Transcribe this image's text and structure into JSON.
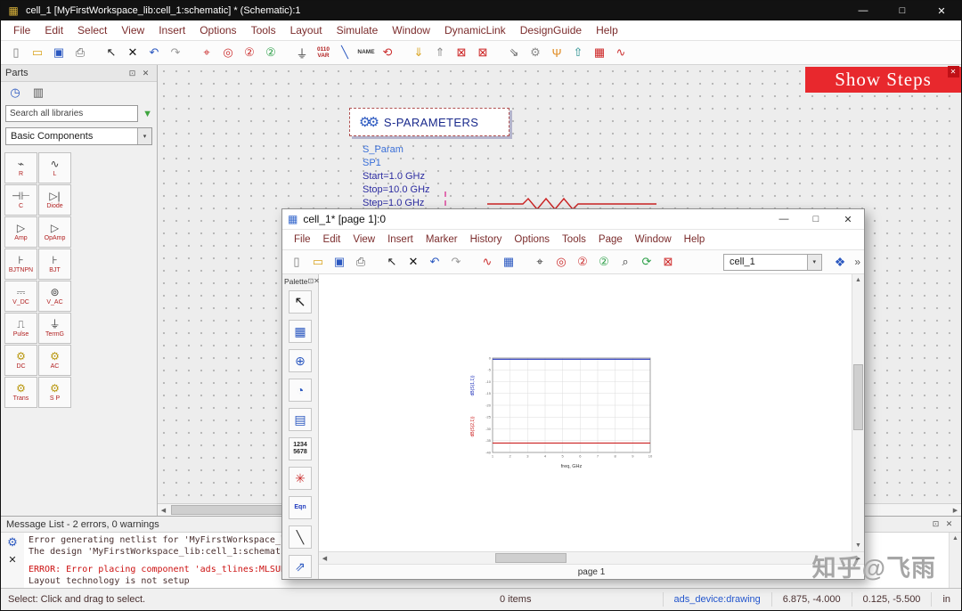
{
  "window": {
    "icon_glyph": "▦",
    "title": "cell_1 [MyFirstWorkspace_lib:cell_1:schematic] * (Schematic):1",
    "controls": {
      "minimize": "—",
      "maximize": "□",
      "close": "✕"
    }
  },
  "menu": [
    "File",
    "Edit",
    "Select",
    "View",
    "Insert",
    "Options",
    "Tools",
    "Layout",
    "Simulate",
    "Window",
    "DynamicLink",
    "DesignGuide",
    "Help"
  ],
  "toolbar": [
    {
      "name": "new-file-button",
      "glyph": "▯",
      "color": "#777777"
    },
    {
      "name": "open-folder-button",
      "glyph": "▭",
      "color": "#d9a31f"
    },
    {
      "name": "save-button",
      "glyph": "▣",
      "color": "#2b58c0"
    },
    {
      "name": "print-button",
      "glyph": "⎙",
      "color": "#555555"
    },
    {
      "name": "select-cursor-button",
      "glyph": "↖",
      "color": "#222222",
      "cls": "group-start"
    },
    {
      "name": "delete-button",
      "glyph": "✕",
      "color": "#111111"
    },
    {
      "name": "undo-button",
      "glyph": "↶",
      "color": "#2b58c0"
    },
    {
      "name": "redo-button",
      "glyph": "↷",
      "color": "#999999"
    },
    {
      "name": "pan-view-button",
      "glyph": "⌖",
      "color": "#cc3030",
      "cls": "group-start"
    },
    {
      "name": "zoom-area-button",
      "glyph": "◎",
      "color": "#cc3030"
    },
    {
      "name": "zoom-out-x2-button",
      "glyph": "②",
      "color": "#cc3030"
    },
    {
      "name": "zoom-in-x2-button",
      "glyph": "②",
      "color": "#2fa04a"
    },
    {
      "name": "insert-ground-button",
      "glyph": "⏚",
      "color": "#333333",
      "cls": "group-start"
    },
    {
      "name": "insert-var-button",
      "glyph": "0110 VAR",
      "color": "#b22222"
    },
    {
      "name": "insert-wire-button",
      "glyph": "╲",
      "color": "#2b58c0"
    },
    {
      "name": "wire-name-button",
      "glyph": "NAME",
      "color": "#333333"
    },
    {
      "name": "wire-loop-button",
      "glyph": "⟲",
      "color": "#cc3030"
    },
    {
      "name": "import-button",
      "glyph": "⇓",
      "color": "#d9a31f",
      "cls": "group-start"
    },
    {
      "name": "export-button",
      "glyph": "⇑",
      "color": "#8a8a8a"
    },
    {
      "name": "deactivate-component-button",
      "glyph": "⊠",
      "color": "#cc2222"
    },
    {
      "name": "deactivate-toggle-button",
      "glyph": "⊠",
      "color": "#cc2222"
    },
    {
      "name": "push-into-button",
      "glyph": "⇘",
      "color": "#555555",
      "cls": "group-start"
    },
    {
      "name": "simulation-setup-button",
      "glyph": "⚙",
      "color": "#8a8a8a"
    },
    {
      "name": "tune-parameters-button",
      "glyph": "Ψ",
      "color": "#e08a1f"
    },
    {
      "name": "simulate-button",
      "glyph": "⇧",
      "color": "#1f8a8a"
    },
    {
      "name": "stop-simulation-button",
      "glyph": "▦",
      "color": "#cc2222"
    },
    {
      "name": "data-display-button",
      "glyph": "∿",
      "color": "#cc3030"
    }
  ],
  "parts_panel": {
    "title": "Parts",
    "float_icon": "⊡",
    "close_icon": "✕",
    "tools": [
      {
        "name": "history-icon",
        "glyph": "◷",
        "color": "#2b58c0"
      },
      {
        "name": "library-browser-icon",
        "glyph": "▥",
        "color": "#555555"
      }
    ],
    "search_placeholder": "Search all libraries",
    "filter_glyph": "▼",
    "library_select": "Basic Components",
    "select_caret": "▾",
    "components": [
      {
        "name": "part-resistor",
        "label": "R",
        "glyph": "⌁",
        "color": "#444444"
      },
      {
        "name": "part-inductor",
        "label": "L",
        "glyph": "∿",
        "color": "#444444"
      },
      {
        "name": "part-capacitor",
        "label": "C",
        "glyph": "⊣⊢",
        "color": "#444444"
      },
      {
        "name": "part-diode",
        "label": "Diode",
        "glyph": "▷|",
        "color": "#444444"
      },
      {
        "name": "part-amp",
        "label": "Amp",
        "glyph": "▷",
        "color": "#444444"
      },
      {
        "name": "part-opamp",
        "label": "OpAmp",
        "glyph": "▷",
        "color": "#444444"
      },
      {
        "name": "part-bjt-npn",
        "label": "BJTNPN",
        "glyph": "⊦",
        "color": "#444444"
      },
      {
        "name": "part-bjt",
        "label": "BJT",
        "glyph": "⊦",
        "color": "#444444"
      },
      {
        "name": "part-vdc",
        "label": "V_DC",
        "glyph": "⎓",
        "color": "#444444"
      },
      {
        "name": "part-vac",
        "label": "V_AC",
        "glyph": "⊚",
        "color": "#444444"
      },
      {
        "name": "part-vpulse",
        "label": "Pulse",
        "glyph": "⎍",
        "color": "#444444"
      },
      {
        "name": "part-term-gnd",
        "label": "TermG",
        "glyph": "⏚",
        "color": "#444444"
      },
      {
        "name": "part-dc-sim",
        "label": "DC",
        "glyph": "⚙",
        "color": "#b8960c"
      },
      {
        "name": "part-ac-sim",
        "label": "AC",
        "glyph": "⚙",
        "color": "#b8960c"
      },
      {
        "name": "part-trans-sim",
        "label": "Trans",
        "glyph": "⚙",
        "color": "#b8960c"
      },
      {
        "name": "part-sparam-sim",
        "label": "S P",
        "glyph": "⚙",
        "color": "#b8960c"
      }
    ]
  },
  "schematic": {
    "gears_glyph": "⚙⚙",
    "sparams_title": "S-PARAMETERS",
    "lines": [
      {
        "text": "S_Param",
        "color": "#3a6fd8"
      },
      {
        "text": "SP1",
        "color": "#3a6fd8"
      },
      {
        "text": "Start=1.0 GHz",
        "color": "#2b2ba0"
      },
      {
        "text": "Stop=10.0 GHz",
        "color": "#2b2ba0"
      },
      {
        "text": "Step=1.0 GHz",
        "color": "#2b2ba0"
      }
    ]
  },
  "banner": {
    "text": "Show Steps",
    "close_glyph": "✕",
    "color": "#e8282d"
  },
  "scrollbars": {
    "left_arrow": "◀",
    "right_arrow": "▶",
    "up_arrow": "▲",
    "down_arrow": "▼"
  },
  "child_window": {
    "icon_glyph": "▦",
    "title": "cell_1* [page 1]:0",
    "controls": {
      "minimize": "—",
      "maximize": "□",
      "close": "✕"
    },
    "menu": [
      "File",
      "Edit",
      "View",
      "Insert",
      "Marker",
      "History",
      "Options",
      "Tools",
      "Page",
      "Window",
      "Help"
    ],
    "toolbar": [
      {
        "name": "new-file-button",
        "glyph": "▯",
        "color": "#777777"
      },
      {
        "name": "open-folder-button",
        "glyph": "▭",
        "color": "#d9a31f"
      },
      {
        "name": "save-button",
        "glyph": "▣",
        "color": "#2b58c0"
      },
      {
        "name": "print-button",
        "glyph": "⎙",
        "color": "#555555"
      },
      {
        "name": "select-cursor-button",
        "glyph": "↖",
        "color": "#222222",
        "cls": "group-start"
      },
      {
        "name": "delete-button",
        "glyph": "✕",
        "color": "#111111"
      },
      {
        "name": "undo-button",
        "glyph": "↶",
        "color": "#2b58c0"
      },
      {
        "name": "redo-button",
        "glyph": "↷",
        "color": "#999999"
      },
      {
        "name": "insert-marker-button",
        "glyph": "∿",
        "color": "#cc3030",
        "cls": "group-start"
      },
      {
        "name": "insert-plot-button",
        "glyph": "▦",
        "color": "#2b58c0"
      },
      {
        "name": "pan-view-button",
        "glyph": "⌖",
        "color": "#333333",
        "cls": "group-start"
      },
      {
        "name": "zoom-area-button",
        "glyph": "◎",
        "color": "#cc3030"
      },
      {
        "name": "zoom-out-x2-button",
        "glyph": "②",
        "color": "#cc3030"
      },
      {
        "name": "zoom-in-x2-button",
        "glyph": "②",
        "color": "#2fa04a"
      },
      {
        "name": "zoom-tool-button",
        "glyph": "⌕",
        "color": "#333333"
      },
      {
        "name": "refresh-button",
        "glyph": "⟳",
        "color": "#2fa04a"
      },
      {
        "name": "close-page-button",
        "glyph": "⊠",
        "color": "#cc2222"
      }
    ],
    "dataset_select": "cell_1",
    "select_caret": "▾",
    "default_icon_glyph": "❖",
    "overflow_glyph": "»",
    "palette": {
      "title": "Palette",
      "float_icon": "⊡",
      "close_icon": "✕",
      "items": [
        {
          "name": "palette-cursor",
          "glyph": "↖",
          "color": "#222222",
          "cls": "big"
        },
        {
          "name": "palette-rect-plot",
          "glyph": "▦",
          "color": "#2b58c0"
        },
        {
          "name": "palette-polar-plot",
          "glyph": "⊕",
          "color": "#2b58c0"
        },
        {
          "name": "palette-smith-chart",
          "glyph": "◔",
          "color": "#2b58c0"
        },
        {
          "name": "palette-stacked-plot",
          "glyph": "▤",
          "color": "#2b58c0"
        },
        {
          "name": "palette-list-data",
          "glyph": "1234 5678",
          "color": "#222222"
        },
        {
          "name": "palette-antenna-plot",
          "glyph": "✳",
          "color": "#cc3030"
        },
        {
          "name": "palette-equation",
          "glyph": "Eqn",
          "color": "#1f3bbf"
        },
        {
          "name": "palette-line-tool",
          "glyph": "╲",
          "color": "#333333"
        },
        {
          "name": "palette-arrow-shape",
          "glyph": "⇗",
          "color": "#2b58c0"
        }
      ]
    },
    "page_label": "page 1"
  },
  "chart_data": {
    "type": "line",
    "title": "",
    "xlabel": "freq, GHz",
    "ylabel": "",
    "xlim": [
      1,
      10
    ],
    "ylim": [
      -40,
      0
    ],
    "xtick_step": 1,
    "ytick_step": 5,
    "grid": true,
    "legend_position": "left-rotated",
    "x": [
      1,
      2,
      3,
      4,
      5,
      6,
      7,
      8,
      9,
      10
    ],
    "series": [
      {
        "name": "dB(S(1,1))",
        "color": "#2233bb",
        "values": [
          -0.5,
          -0.5,
          -0.5,
          -0.5,
          -0.5,
          -0.5,
          -0.5,
          -0.5,
          -0.5,
          -0.5
        ]
      },
      {
        "name": "dB(S(2,1))",
        "color": "#cc2222",
        "values": [
          -36,
          -36,
          -36,
          -36,
          -36,
          -36,
          -36,
          -36,
          -36,
          -36
        ]
      }
    ]
  },
  "message_list": {
    "header": "Message List - 2 errors, 0 warnings",
    "float_icon": "⊡",
    "close_icon": "✕",
    "gear_glyph": "⚙",
    "x_glyph": "✕",
    "lines": [
      {
        "text": "Error generating netlist for 'MyFirstWorkspace_lib:cell_1:sc",
        "color": "#4a3030"
      },
      {
        "text": "The design 'MyFirstWorkspace_lib:cell_1:schematic' has no i",
        "color": "#4a3030"
      },
      {
        "text": "ERROR: Error placing component 'ads_tlines:MLSUBSTRATE2:symb",
        "color": "#cc1111"
      },
      {
        "text": "Layout technology is not setup",
        "color": "#4a3030"
      }
    ]
  },
  "statusbar": {
    "hint": "Select: Click and drag to select.",
    "items": "0 items",
    "layer": "ads_device:drawing",
    "coord1": "6.875, -4.000",
    "coord2": "0.125, -5.500",
    "units": "in"
  },
  "watermark": "知乎@飞雨"
}
